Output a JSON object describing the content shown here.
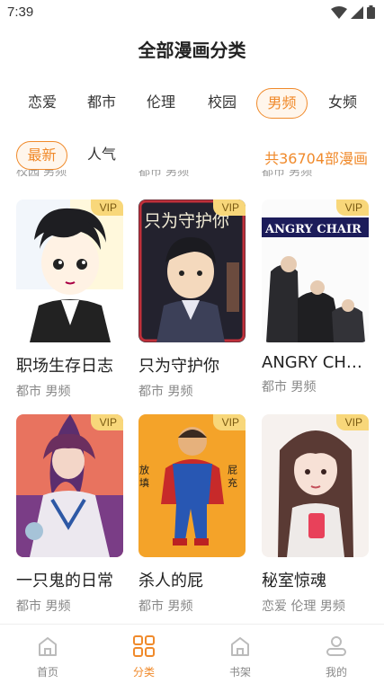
{
  "status": {
    "time": "7:39"
  },
  "page_title": "全部漫画分类",
  "categories": [
    "恋爱",
    "都市",
    "伦理",
    "校园",
    "男频",
    "女频"
  ],
  "active_category": "男频",
  "sorts": [
    "最新",
    "人气"
  ],
  "active_sort": "最新",
  "total_text": "共36704部漫画",
  "peek_tags": [
    "校园 男频",
    "都市 男频",
    "都市 男频"
  ],
  "vip_label": "VIP",
  "comics": [
    {
      "title": "职场生存日志",
      "tags": "都市 男频",
      "cover_text": ""
    },
    {
      "title": "只为守护你",
      "tags": "都市 男频",
      "cover_text": "只为守护你"
    },
    {
      "title": "ANGRY CHA...",
      "tags": "都市 男频",
      "cover_text": "ANGRY CHAIR"
    },
    {
      "title": "一只鬼的日常",
      "tags": "都市 男频",
      "cover_text": ""
    },
    {
      "title": "杀人的屁",
      "tags": "都市 男频",
      "cover_text_left": "放 填",
      "cover_text_right": "屁 充"
    },
    {
      "title": "秘室惊魂",
      "tags": "恋爱 伦理 男频",
      "cover_text": ""
    }
  ],
  "tabs": [
    {
      "label": "首页",
      "icon": "home-icon"
    },
    {
      "label": "分类",
      "icon": "grid-icon"
    },
    {
      "label": "书架",
      "icon": "bookshelf-icon"
    },
    {
      "label": "我的",
      "icon": "profile-icon"
    }
  ],
  "active_tab": "分类",
  "colors": {
    "accent": "#f08a2b",
    "vip_bg": "#f8d77a"
  }
}
